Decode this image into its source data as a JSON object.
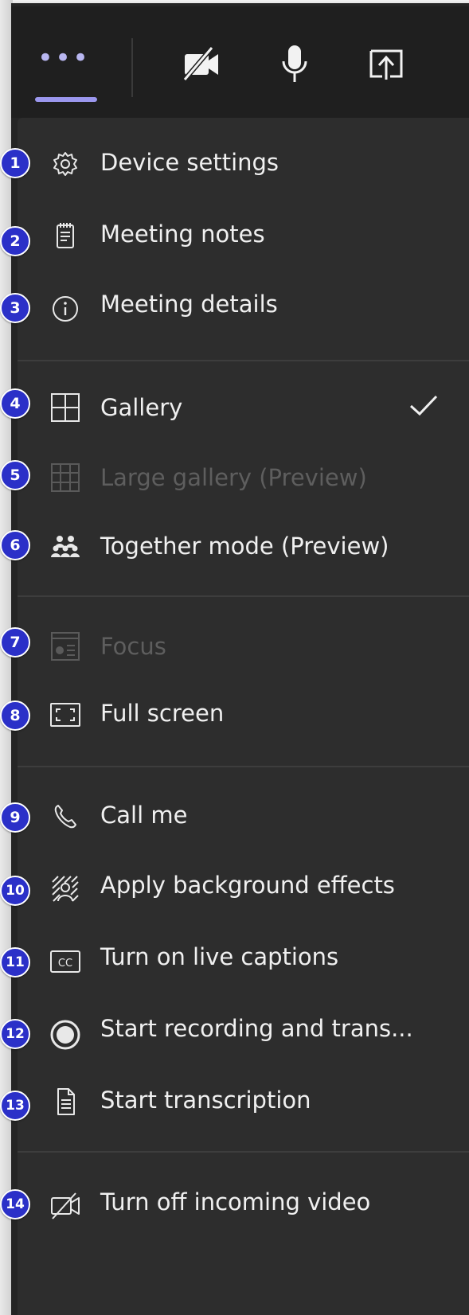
{
  "toolbar": {
    "more_icon": "more-dots-icon",
    "more_glyph": "•••",
    "camera_icon": "video-off-icon",
    "mic_icon": "microphone-icon",
    "share_icon": "share-tray-icon"
  },
  "menu": {
    "items": [
      {
        "badge": "1",
        "label": "Device settings",
        "icon": "gear-icon"
      },
      {
        "badge": "2",
        "label": "Meeting notes",
        "icon": "notes-icon"
      },
      {
        "badge": "3",
        "label": "Meeting details",
        "icon": "info-icon"
      },
      {
        "badge": "4",
        "label": "Gallery",
        "icon": "gallery-grid-icon",
        "checked": true
      },
      {
        "badge": "5",
        "label": "Large gallery (Preview)",
        "icon": "large-gallery-icon",
        "disabled": true
      },
      {
        "badge": "6",
        "label": "Together mode (Preview)",
        "icon": "together-mode-icon"
      },
      {
        "badge": "7",
        "label": "Focus",
        "icon": "focus-icon",
        "disabled": true
      },
      {
        "badge": "8",
        "label": "Full screen",
        "icon": "full-screen-icon"
      },
      {
        "badge": "9",
        "label": "Call me",
        "icon": "phone-icon"
      },
      {
        "badge": "10",
        "label": "Apply background effects",
        "icon": "background-effects-icon"
      },
      {
        "badge": "11",
        "label": "Turn on live captions",
        "icon": "captions-icon"
      },
      {
        "badge": "12",
        "label": "Start recording and trans...",
        "icon": "record-icon"
      },
      {
        "badge": "13",
        "label": "Start transcription",
        "icon": "transcript-icon"
      },
      {
        "badge": "14",
        "label": "Turn off incoming video",
        "icon": "incoming-video-off-icon"
      }
    ]
  },
  "colors": {
    "toolbar_bg": "#1f1f1f",
    "menu_bg": "#2d2d2d",
    "accent": "#9b97ee",
    "badge": "#2b30c8",
    "text": "#f0f0f0",
    "disabled_text": "#5e5e5e"
  }
}
